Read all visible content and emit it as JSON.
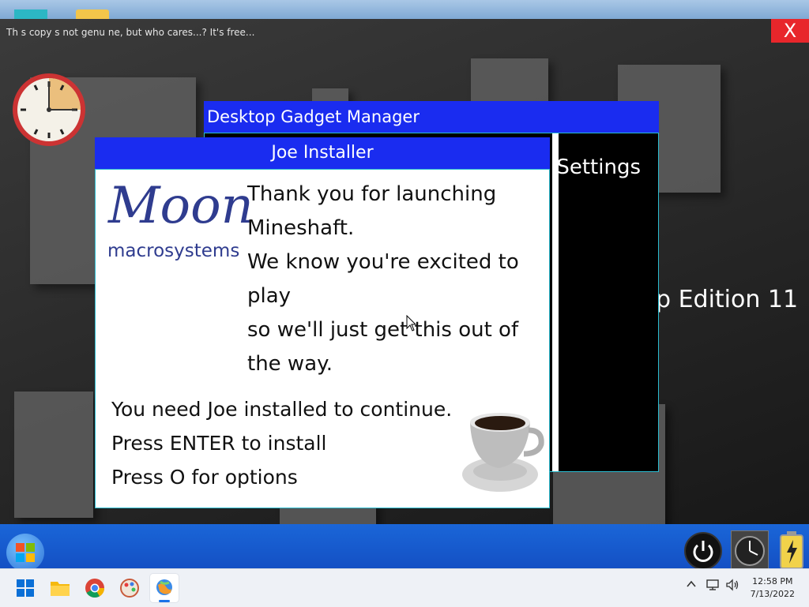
{
  "notice": {
    "text": "Th s copy s not genu ne, but who cares...? It's free..."
  },
  "close_button": {
    "label": "X"
  },
  "edition_text": "p Edition 11",
  "gadget_manager": {
    "title": "Desktop Gadget Manager",
    "settings": "Settings"
  },
  "installer": {
    "title": "Joe Installer",
    "logo": {
      "name": "Moon",
      "tagline": "macrosystems"
    },
    "thanks": [
      "Thank you for launching Mineshaft.",
      "We know you're excited to play",
      "so we'll just get this out of the way."
    ],
    "instructions": [
      "You need Joe installed to continue.",
      "Press ENTER to install",
      "Press O for options"
    ]
  },
  "gadgets": [
    "clock-icon",
    "power-icon",
    "clock-gadget-icon",
    "battery-icon"
  ],
  "taskbar": {
    "apps": [
      "windows-start-icon",
      "file-explorer-icon",
      "chrome-icon",
      "paint-icon",
      "globe-app-icon"
    ],
    "tray_icons": [
      "chevron-up-icon",
      "network-icon",
      "volume-icon"
    ],
    "time": "12:58 PM",
    "date": "7/13/2022"
  },
  "colors": {
    "title_blue": "#1a2cf0",
    "accent_cyan": "#2bbcd0",
    "close_red": "#e8262b",
    "logo_blue": "#2f3c8f"
  }
}
